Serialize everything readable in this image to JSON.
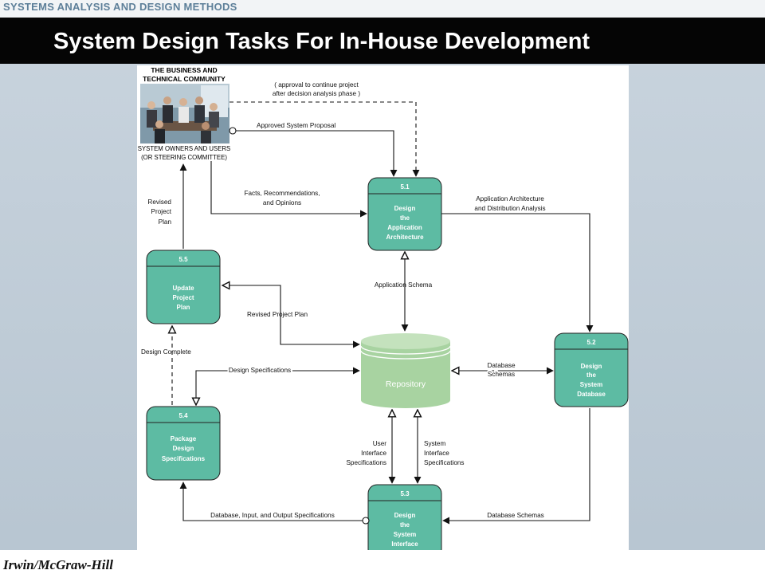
{
  "header": {
    "course": "SYSTEMS ANALYSIS AND DESIGN METHODS",
    "title": "System Design Tasks For In-House Development"
  },
  "footer": {
    "publisher": "Irwin/McGraw-Hill"
  },
  "colors": {
    "process_fill": "#5dbba3",
    "repository_fill": "#a8d3a1",
    "titlebar": "#050505"
  },
  "diagram": {
    "external": {
      "title_lines": [
        "THE BUSINESS AND",
        "TECHNICAL COMMUNITY"
      ],
      "caption_lines": [
        "SYSTEM OWNERS AND USERS",
        "(OR STEERING COMMITTEE)"
      ],
      "photo": "people-meeting-photo"
    },
    "processes": [
      {
        "id": "5.1",
        "lines": [
          "Design",
          "the",
          "Application",
          "Architecture"
        ]
      },
      {
        "id": "5.2",
        "lines": [
          "Design",
          "the",
          "System",
          "Database"
        ]
      },
      {
        "id": "5.3",
        "lines": [
          "Design",
          "the",
          "System",
          "Interface"
        ]
      },
      {
        "id": "5.4",
        "lines": [
          "Package",
          "Design",
          "Specifications"
        ]
      },
      {
        "id": "5.5",
        "lines": [
          "Update",
          "Project",
          "Plan"
        ]
      }
    ],
    "repository": "Repository",
    "flows": {
      "approval": [
        "( approval to continue project",
        "after decision analysis phase )"
      ],
      "approved_proposal": "Approved System Proposal",
      "facts": [
        "Facts, Recommendations,",
        "and Opinions"
      ],
      "app_arch": [
        "Application Architecture",
        "and Distribution Analysis"
      ],
      "app_schema": "Application Schema",
      "revised_plan_up": [
        "Revised",
        "Project",
        "Plan"
      ],
      "revised_plan": "Revised Project Plan",
      "design_complete": "Design Complete",
      "design_specs": "Design Specifications",
      "db_schemas_repo": [
        "Database",
        "Schemas"
      ],
      "user_interface": [
        "User",
        "Interface",
        "Specifications"
      ],
      "system_interface": [
        "System",
        "Interface",
        "Specifications"
      ],
      "db_input_output": "Database, Input, and Output Specifications",
      "db_schemas_bottom": "Database Schemas"
    }
  }
}
